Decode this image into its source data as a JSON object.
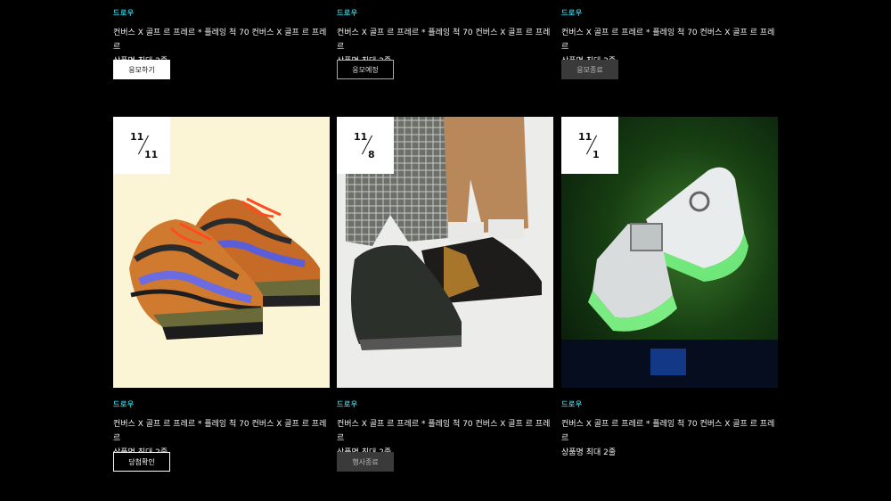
{
  "top_row": [
    {
      "tag": "드로우",
      "title_line1": "컨버스 X 골프 르 프레르 * 플레잉 척 70 컨버스 X 골프 르 프레르",
      "title_line2": "상품명 최대 2줄",
      "button": "응모하기"
    },
    {
      "tag": "드로우",
      "title_line1": "컨버스 X 골프 르 프레르 * 플레잉 척 70 컨버스 X 골프 르 프레르",
      "title_line2": "상품명 최대 2줄",
      "button": "응모예정"
    },
    {
      "tag": "드로우",
      "title_line1": "컨버스 X 골프 르 프레르 * 플레잉 척 70 컨버스 X 골프 르 프레르",
      "title_line2": "상품명 최대 2줄",
      "button": "응모종료"
    }
  ],
  "bottom_row": [
    {
      "month": "11",
      "day": "11",
      "tag": "드로우",
      "title_line1": "컨버스 X 골프 르 프레르 * 플레잉 척 70 컨버스 X 골프 르 프레르",
      "title_line2": "상품명 최대 2줄",
      "button": "당첨확인",
      "bg": "#fbf5d6"
    },
    {
      "month": "11",
      "day": "8",
      "tag": "드로우",
      "title_line1": "컨버스 X 골프 르 프레르 * 플레잉 척 70 컨버스 X 골프 르 프레르",
      "title_line2": "상품명 최대 2줄",
      "button": "행사종료",
      "bg": "#ececea"
    },
    {
      "month": "11",
      "day": "1",
      "tag": "드로우",
      "title_line1": "컨버스 X 골프 르 프레르 * 플레잉 척 70 컨버스 X 골프 르 프레르",
      "title_line2": "상품명 최대 2줄",
      "bg": "#0a1a0c"
    }
  ]
}
